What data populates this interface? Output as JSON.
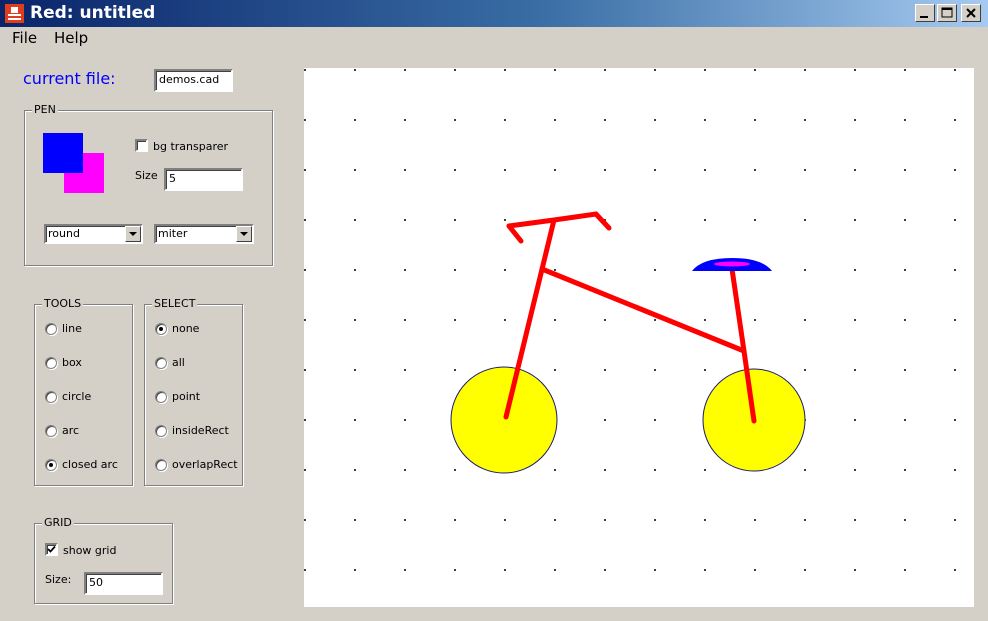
{
  "window": {
    "title": "Red: untitled"
  },
  "menu": {
    "file": "File",
    "help": "Help"
  },
  "current_file": {
    "label": "current file:",
    "value": "demos.cad"
  },
  "pen": {
    "title": "PEN",
    "fg_color": "#0000ff",
    "bg_color": "#ff00ff",
    "bg_transparent_label": "bg transparer",
    "bg_transparent_checked": false,
    "size_label": "Size",
    "size_value": "5",
    "cap_style": "round",
    "join_style": "miter"
  },
  "tools": {
    "title": "TOOLS",
    "options": [
      "line",
      "box",
      "circle",
      "arc",
      "closed arc"
    ],
    "selected": "closed arc"
  },
  "select": {
    "title": "SELECT",
    "options": [
      "none",
      "all",
      "point",
      "insideRect",
      "overlapRect"
    ],
    "selected": "none"
  },
  "grid": {
    "title": "GRID",
    "show_label": "show grid",
    "show_checked": true,
    "size_label": "Size:",
    "size_value": "50"
  },
  "drawing": {
    "line_color": "#ff0000",
    "wheel_fill": "#ffff00",
    "wheel_stroke": "#1a1a6e",
    "seat_color": "#0000ff",
    "seat_highlight": "#ff00ff",
    "grid_dot_color": "#000000"
  }
}
